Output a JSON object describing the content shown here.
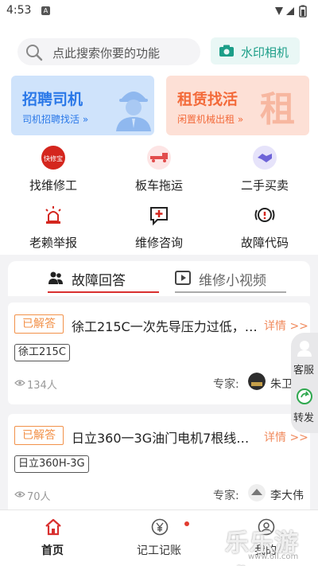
{
  "status_bar": {
    "time": "4:53",
    "notification_badge": "A"
  },
  "search": {
    "placeholder": "点此搜索你要的功能"
  },
  "camera_button": {
    "label": "水印相机"
  },
  "banners": [
    {
      "title": "招聘司机",
      "subtitle": "司机招聘找活 »",
      "color": "#2a78e8"
    },
    {
      "title": "租赁找活",
      "subtitle": "闲置机械出租 »",
      "big_char": "租",
      "color": "#f36a3a"
    }
  ],
  "quick_menu": [
    {
      "label": "找维修工",
      "icon": "repair-badge-icon",
      "icon_text": "快修宝"
    },
    {
      "label": "板车拖运",
      "icon": "tow-truck-icon"
    },
    {
      "label": "二手买卖",
      "icon": "handshake-icon"
    },
    {
      "label": "老赖举报",
      "icon": "alarm-light-icon"
    },
    {
      "label": "维修咨询",
      "icon": "consult-chat-icon"
    },
    {
      "label": "故障代码",
      "icon": "fault-code-icon"
    }
  ],
  "content_tabs": [
    {
      "label": "故障回答",
      "icon": "people-icon",
      "active": true
    },
    {
      "label": "维修小视频",
      "icon": "video-play-icon",
      "active": false
    }
  ],
  "answers": [
    {
      "status": "已解答",
      "question": "徐工215C一次先导压力过低，…",
      "detail_link": "详情 >>",
      "tag": "徐工215C",
      "views": "134人",
      "expert_label": "专家:",
      "expert_name": "朱卫东"
    },
    {
      "status": "已解答",
      "question": "日立360一3G油门电机7根线…",
      "detail_link": "详情 >>",
      "tag": "日立360H-3G",
      "views": "70人",
      "expert_label": "专家:",
      "expert_name": "李大伟"
    }
  ],
  "side_float": {
    "service_label": "客服",
    "share_label": "转发"
  },
  "bottom_nav": [
    {
      "label": "首页",
      "icon": "home-icon",
      "active": true
    },
    {
      "label": "记工记账",
      "icon": "yen-coin-icon",
      "active": false,
      "dot": true
    },
    {
      "label": "我的",
      "icon": "profile-icon",
      "active": false
    }
  ],
  "watermark": {
    "text": "乐乐游戏",
    "url": "www.6ll.com"
  },
  "colors": {
    "accent_red": "#d9302f",
    "teal": "#1c9e88",
    "orange": "#f29149"
  }
}
